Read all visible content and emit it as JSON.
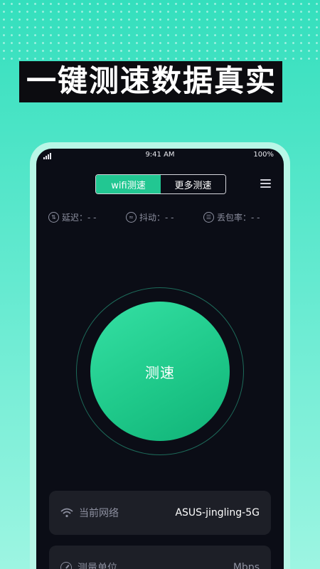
{
  "promo": {
    "headline": "一键测速数据真实"
  },
  "status_bar": {
    "time": "9:41 AM",
    "battery": "100%"
  },
  "tabs": [
    {
      "label": "wifi测速",
      "active": true
    },
    {
      "label": "更多测速",
      "active": false
    }
  ],
  "metrics": [
    {
      "label": "延迟：- -",
      "icon": "latency-icon"
    },
    {
      "label": "抖动：- -",
      "icon": "jitter-icon"
    },
    {
      "label": "丢包率：- -",
      "icon": "packet-loss-icon"
    }
  ],
  "speed_button": {
    "label": "测速"
  },
  "cards": {
    "network": {
      "label": "当前网络",
      "value": "ASUS-jingling-5G",
      "icon": "wifi-icon"
    },
    "unit": {
      "label": "测量单位",
      "value": "Mbps",
      "icon": "gauge-icon"
    }
  },
  "colors": {
    "accent": "#22c792",
    "background": "#0b0d16",
    "card": "#1d1f27",
    "promo_bg": "#34dfbd"
  }
}
